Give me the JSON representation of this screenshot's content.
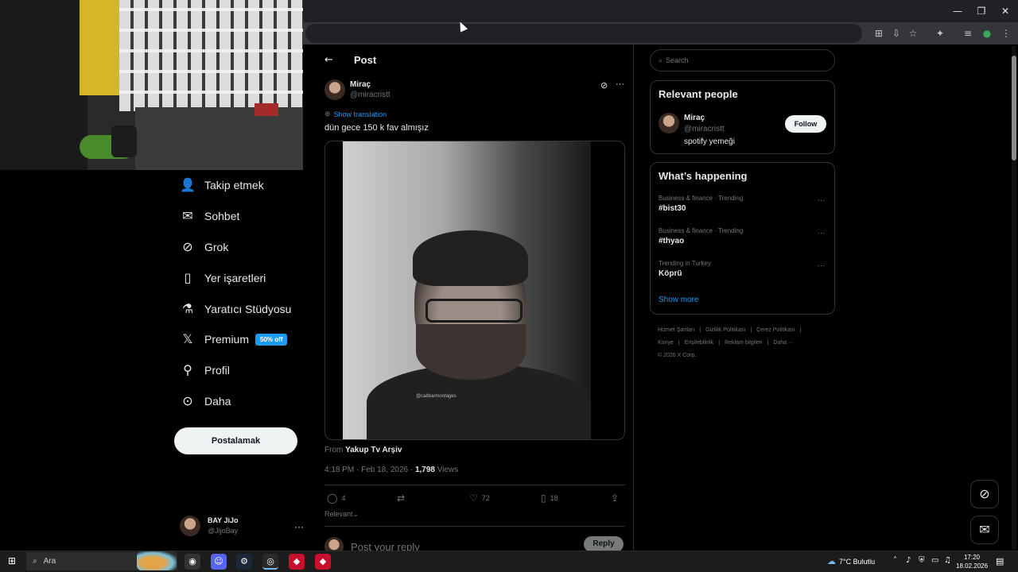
{
  "browser": {
    "window_controls": {
      "minimize": "—",
      "restore": "❐",
      "close": "✕"
    },
    "toolbar_icons": [
      "translate-icon",
      "install-icon",
      "star-icon",
      "extensions-icon",
      "media-icon",
      "profile-icon",
      "menu-icon"
    ]
  },
  "nav": {
    "items": [
      {
        "label": "Takip etmek",
        "icon": "add-user-icon"
      },
      {
        "label": "Sohbet",
        "icon": "mail-icon"
      },
      {
        "label": "Grok",
        "icon": "grok-icon"
      },
      {
        "label": "Yer işaretleri",
        "icon": "bookmark-icon"
      },
      {
        "label": "Yaratıcı Stüdyosu",
        "icon": "flask-icon"
      },
      {
        "label": "Premium",
        "icon": "x-logo-icon",
        "badge": "50% off"
      },
      {
        "label": "Profil",
        "icon": "person-icon"
      },
      {
        "label": "Daha",
        "icon": "more-circle-icon"
      }
    ],
    "post_button": "Postalamak",
    "account": {
      "name": "BAY JiJo",
      "handle": "@JijoBay"
    }
  },
  "post": {
    "header": "Post",
    "author": {
      "name": "Miraç",
      "handle": "@miracristt"
    },
    "show_translation": "Show translation",
    "text": "dün gece 150 k fav almışız",
    "video_watermark": "@cabbarmontages",
    "from_prefix": "From",
    "from_source": "Yakup Tv Arşiv",
    "time": "4:18 PM · Feb 18, 2026 · ",
    "views_count": "1,798",
    "views_label": " Views",
    "actions": {
      "replies": "4",
      "reposts": "",
      "likes": "72",
      "bookmarks": "18"
    },
    "sort": "Relevant",
    "reply_placeholder": "Post your reply",
    "reply_button": "Reply"
  },
  "sidebar": {
    "search_placeholder": "Search",
    "relevant_people": {
      "title": "Relevant people",
      "name": "Miraç",
      "handle": "@miracristt",
      "bio": "spotify yemeği",
      "follow": "Follow"
    },
    "happening": {
      "title": "What’s happening",
      "trends": [
        {
          "category": "Business & finance · Trending",
          "name": "#bist30"
        },
        {
          "category": "Business & finance · Trending",
          "name": "#thyao"
        },
        {
          "category": "Trending in Turkey",
          "name": "Köprü"
        }
      ],
      "show_more": "Show more"
    },
    "footer": {
      "links": [
        "Hizmet Şartları",
        "|",
        "Gizlilik Politikası",
        "|",
        "Çerez Politikası",
        "|",
        "Künye",
        "|",
        "Erişilebilirlik",
        "|",
        "Reklam bilgileri",
        "|",
        "Daha ···"
      ],
      "copyright": "© 2026 X Corp."
    }
  },
  "taskbar": {
    "search_label": "Ara",
    "weather": "7°C  Bulutlu",
    "time": "17:20",
    "date": "18.02.2026"
  },
  "colors": {
    "accent": "#1d9bf0",
    "background": "#000000",
    "border": "#2f3336",
    "muted": "#71767b"
  }
}
